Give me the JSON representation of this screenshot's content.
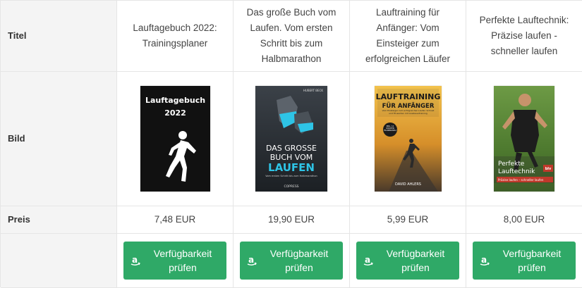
{
  "rows": {
    "title_label": "Titel",
    "image_label": "Bild",
    "price_label": "Preis"
  },
  "products": [
    {
      "title": "Lauftagebuch 2022: Trainingsplaner",
      "price": "7,48 EUR",
      "button_label": "Verfügbarkeit prüfen",
      "cover": {
        "heading": "Lauftagebuch",
        "subheading": "2022",
        "bg": "#111111",
        "fg": "#ffffff"
      }
    },
    {
      "title": "Das große Buch vom Laufen. Vom ersten Schritt bis zum Halbmarathon",
      "price": "19,90 EUR",
      "button_label": "Verfügbarkeit prüfen",
      "cover": {
        "author": "HUBERT BECK",
        "line1": "DAS GROSSE",
        "line2": "BUCH VOM",
        "line3": "LAUFEN",
        "tagline": "Vom ersten Schritt bis zum Halbmarathon",
        "publisher": "COPRESS",
        "bg": "#2a2f35",
        "accent": "#2ec4e6"
      }
    },
    {
      "title": "Lauftraining für Anfänger: Vom Einsteiger zum erfolgreichen Läufer",
      "price": "5,99 EUR",
      "button_label": "Verfügbarkeit prüfen",
      "cover": {
        "line1": "LAUFTRAINING",
        "line2": "FÜR ANFÄNGER",
        "blurb": "Vom Einsteiger zum erfolgreichen Läufer. Schnell und fit werden mit Ausdauertraining",
        "author": "DAVID AHLERS",
        "badge": "INKL. 12 WOCHEN TRAININGSPLAN",
        "bg": "#e8b43a"
      }
    },
    {
      "title": "Perfekte Lauftechnik: Präzise laufen - schneller laufen",
      "price": "8,00 EUR",
      "button_label": "Verfügbarkeit prüfen",
      "cover": {
        "line1": "Perfekte",
        "line2": "Lauftechnik",
        "tagline": "Präzise laufen – schneller laufen",
        "publisher": "blv",
        "bg": "#5f8a3c",
        "band": "#c0392b"
      }
    }
  ],
  "colors": {
    "button_bg": "#2fa967",
    "border": "#e5e5e5",
    "header_bg": "#f4f4f4"
  },
  "icons": {
    "button_icon": "amazon-icon"
  }
}
